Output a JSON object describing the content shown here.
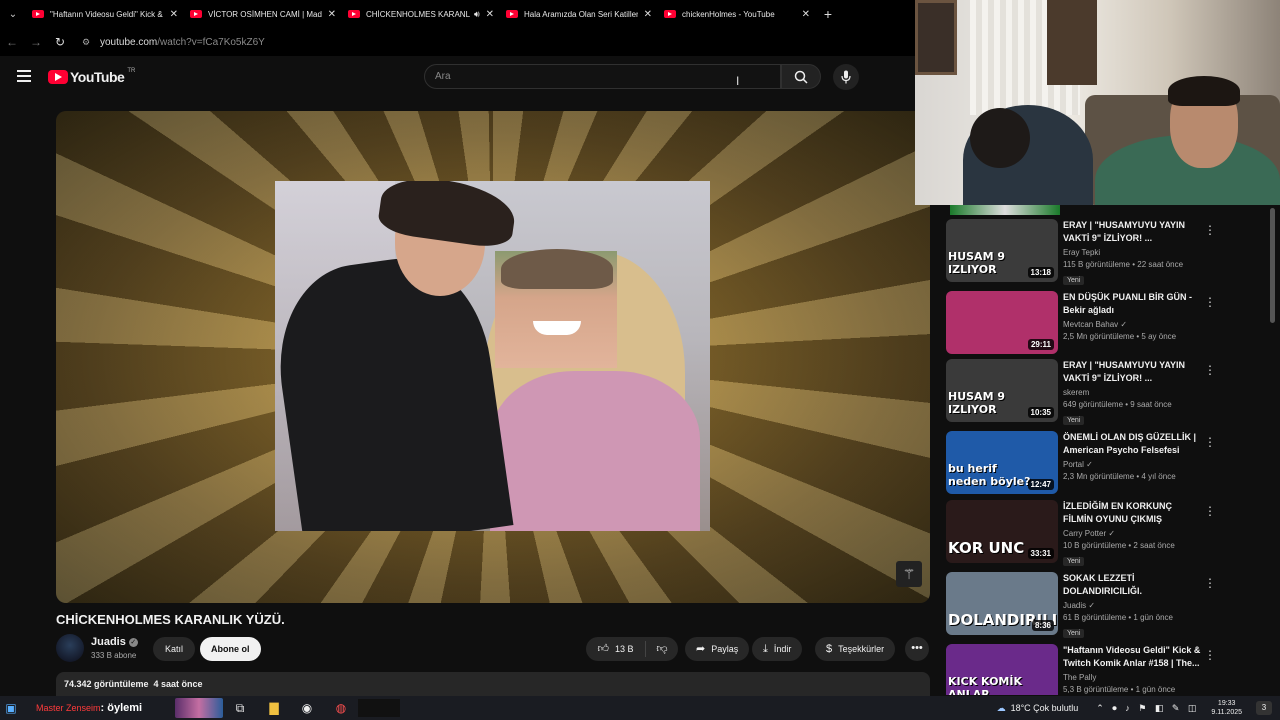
{
  "tabs": [
    {
      "title": "\"Haftanın Videosu Geldi\" Kick &",
      "active": false
    },
    {
      "title": "VİCTOR OSİMHEN CAMİ | Madı",
      "active": false
    },
    {
      "title": "CHİCKENHOLMES KARANLIK",
      "active": true,
      "audio": true
    },
    {
      "title": "Hala Aramızda Olan Seri Katiller",
      "active": false
    },
    {
      "title": "chickenHolmes - YouTube",
      "active": false
    }
  ],
  "address": {
    "host": "youtube.com",
    "path": "/watch?v=fCa7Ko5kZ6Y"
  },
  "header": {
    "logo": "YouTube",
    "country": "TR",
    "search_placeholder": "Ara"
  },
  "video": {
    "title": "CHİCKENHOLMES KARANLIK YÜZÜ.",
    "channel": "Juadis",
    "subscribers": "333 B abone",
    "join_label": "Katıl",
    "subscribe_label": "Abone ol",
    "likes": "13 B",
    "share_label": "Paylaş",
    "download_label": "İndir",
    "thanks_label": "Teşekkürler",
    "views": "74.342 görüntüleme",
    "age": "4 saat önce"
  },
  "recommendations": [
    {
      "title": "ERAY | \"HUSAMYUYU YAYIN VAKTİ 9\" İZLİYOR! ...",
      "channel": "Eray Tepki",
      "verified": false,
      "meta": "115 B görüntüleme • 22 saat önce",
      "badge": "Yeni",
      "duration": "13:18",
      "caption": "HUSAM 9\nIZLIYOR",
      "color": "#3b3b3b"
    },
    {
      "title": "EN DÜŞÜK PUANLI BİR GÜN - Bekir ağladı",
      "channel": "Mevtcan Bahav",
      "verified": true,
      "meta": "2,5 Mn görüntüleme • 5 ay önce",
      "badge": "",
      "duration": "29:11",
      "caption": "",
      "color": "#b0306a"
    },
    {
      "title": "ERAY | \"HUSAMYUYU YAYIN VAKTİ 9\" İZLİYOR! ...",
      "channel": "skerem",
      "verified": false,
      "meta": "649 görüntüleme • 9 saat önce",
      "badge": "Yeni",
      "duration": "10:35",
      "caption": "HUSAM 9\nIZLIYOR",
      "color": "#3a3a3a"
    },
    {
      "title": "ÖNEMLİ OLAN DIŞ GÜZELLİK | American Psycho Felsefesi",
      "channel": "Portal",
      "verified": true,
      "meta": "2,3 Mn görüntüleme • 4 yıl önce",
      "badge": "",
      "duration": "12:47",
      "caption": "bu herif\nneden böyle?",
      "color": "#1f5aa8"
    },
    {
      "title": "İZLEDİĞİM EN KORKUNÇ FİLMİN OYUNU ÇIKMIŞ",
      "channel": "Carry Potter",
      "verified": true,
      "meta": "10 B görüntüleme • 2 saat önce",
      "badge": "Yeni",
      "duration": "33:31",
      "caption": "KOR UNC",
      "color": "#2a1a1a"
    },
    {
      "title": "SOKAK LEZZETİ DOLANDIRICILIĞI.",
      "channel": "Juadis",
      "verified": true,
      "meta": "61 B görüntüleme • 1 gün önce",
      "badge": "Yeni",
      "duration": "8:36",
      "caption": "DOLANDIRILI",
      "color": "#6a7a8a"
    },
    {
      "title": "\"Haftanın Videosu Geldi\" Kick & Twitch Komik Anlar #158 | The...",
      "channel": "The Pally",
      "verified": false,
      "meta": "5,3 B görüntüleme • 1 gün önce",
      "badge": "",
      "duration": "",
      "caption": "KICK KOMİK ANLAR",
      "color": "#6a2a8a"
    }
  ],
  "taskbar": {
    "search_red": "Master Zenseim",
    "search_text": ": öylemi",
    "weather": "18°C  Çok bulutlu",
    "time": "19:33",
    "date": "9.11.2025",
    "notifications": "3"
  },
  "colors": {
    "accent": "#ff0033",
    "background": "#0f0f0f"
  },
  "icons": [
    "menu-icon",
    "search-icon",
    "mic-icon",
    "like-icon",
    "dislike-icon",
    "share-icon",
    "download-icon",
    "thanks-icon",
    "more-icon",
    "verified-icon"
  ]
}
